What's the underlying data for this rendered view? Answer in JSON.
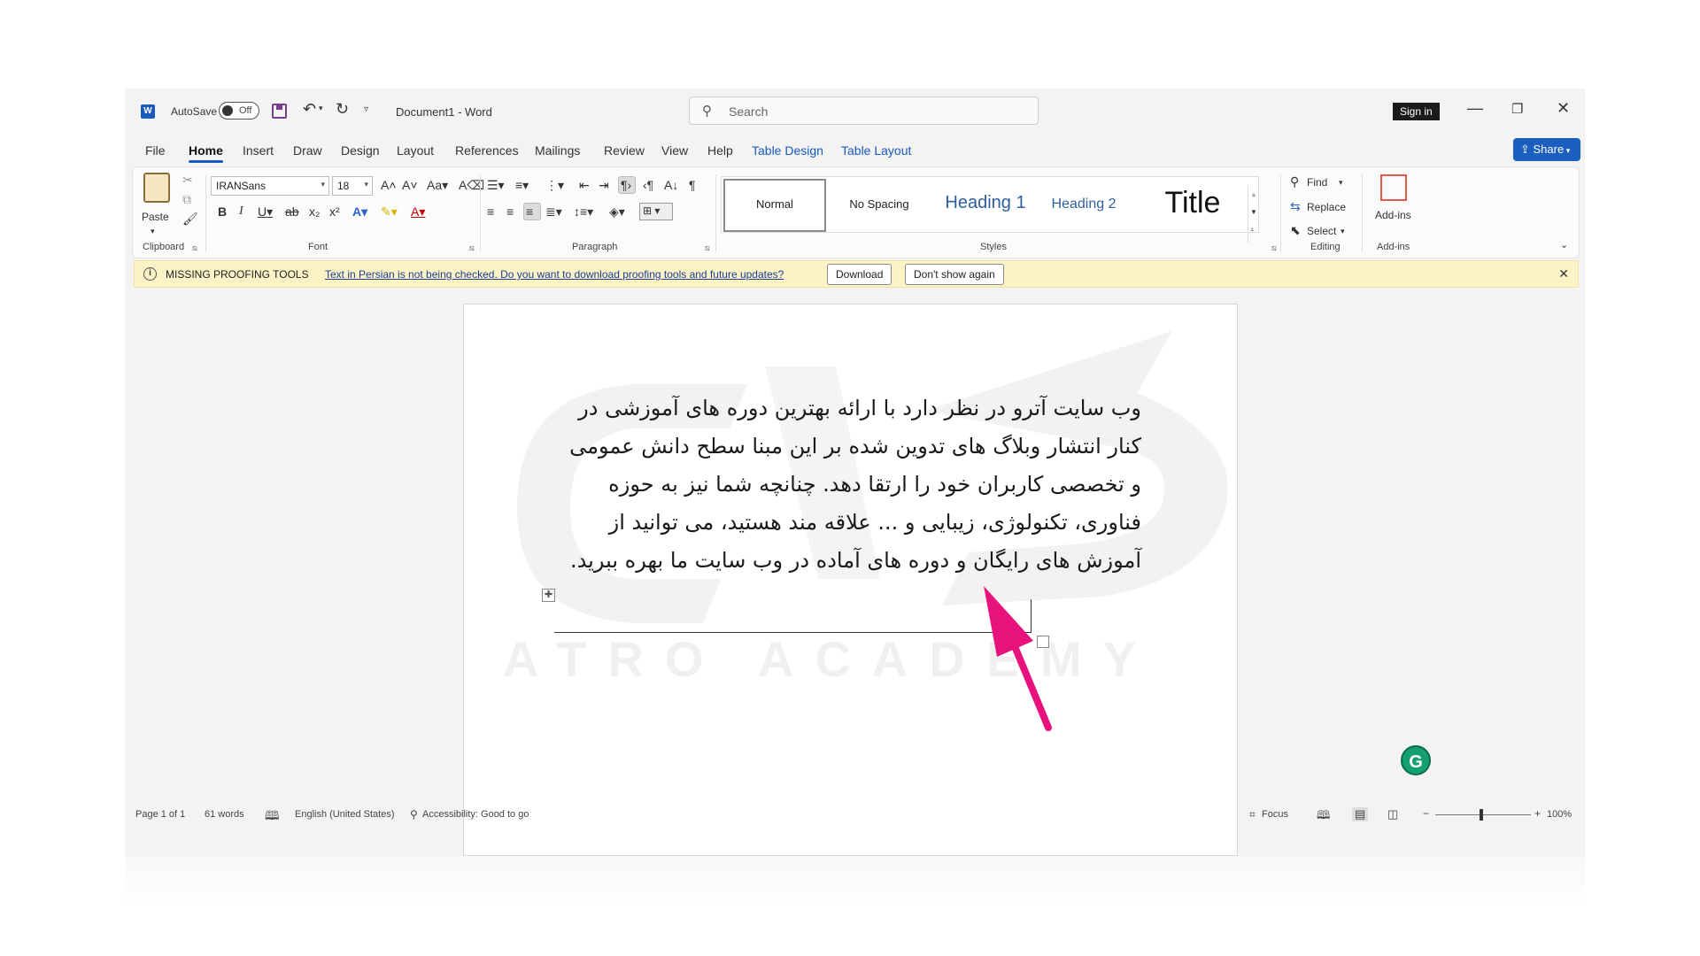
{
  "titlebar": {
    "autosave_label": "AutoSave",
    "autosave_state": "Off",
    "doc_title": "Document1  -  Word",
    "search_placeholder": "Search",
    "signin": "Sign in",
    "app_icon": "W"
  },
  "tabs": [
    "File",
    "Home",
    "Insert",
    "Draw",
    "Design",
    "Layout",
    "References",
    "Mailings",
    "Review",
    "View",
    "Help",
    "Table Design",
    "Table Layout"
  ],
  "active_tab": "Home",
  "share_label": "Share",
  "ribbon": {
    "clipboard": {
      "label": "Clipboard",
      "paste": "Paste"
    },
    "font": {
      "label": "Font",
      "font_name": "IRANSans",
      "font_size": "18"
    },
    "paragraph": {
      "label": "Paragraph"
    },
    "styles": {
      "label": "Styles",
      "items": [
        "Normal",
        "No Spacing",
        "Heading 1",
        "Heading 2",
        "Title"
      ]
    },
    "editing": {
      "label": "Editing",
      "find": "Find",
      "replace": "Replace",
      "select": "Select"
    },
    "addins": {
      "label": "Add-ins",
      "button": "Add-ins"
    }
  },
  "infobar": {
    "title": "MISSING PROOFING TOOLS",
    "message": "Text in Persian is not being checked. Do you want to download proofing tools and future updates?",
    "download": "Download",
    "dont_show": "Don't show again"
  },
  "document": {
    "lines": [
      "وب سایت آترو در نظر دارد با ارائه بهترین دوره های آموزشی در",
      "کنار انتشار وبلاگ های تدوین شده بر این مبنا سطح دانش عمومی",
      "و تخصصی کاربران خود را ارتقا دهد. چنانچه شما نیز به حوزه",
      "فناوری، تکنولوژی، زیبایی و ... علاقه مند هستید، می توانید از",
      "آموزش های رایگان و دوره های آماده در وب سایت ما بهره ببرید."
    ],
    "watermark": "ATRO ACADEMY"
  },
  "statusbar": {
    "page": "Page 1 of 1",
    "words": "61 words",
    "language": "English (United States)",
    "accessibility": "Accessibility: Good to go",
    "focus": "Focus",
    "zoom": "100%"
  },
  "colors": {
    "accent": "#185abd",
    "arrow": "#e8127c",
    "infobar": "#fbf2c6"
  }
}
